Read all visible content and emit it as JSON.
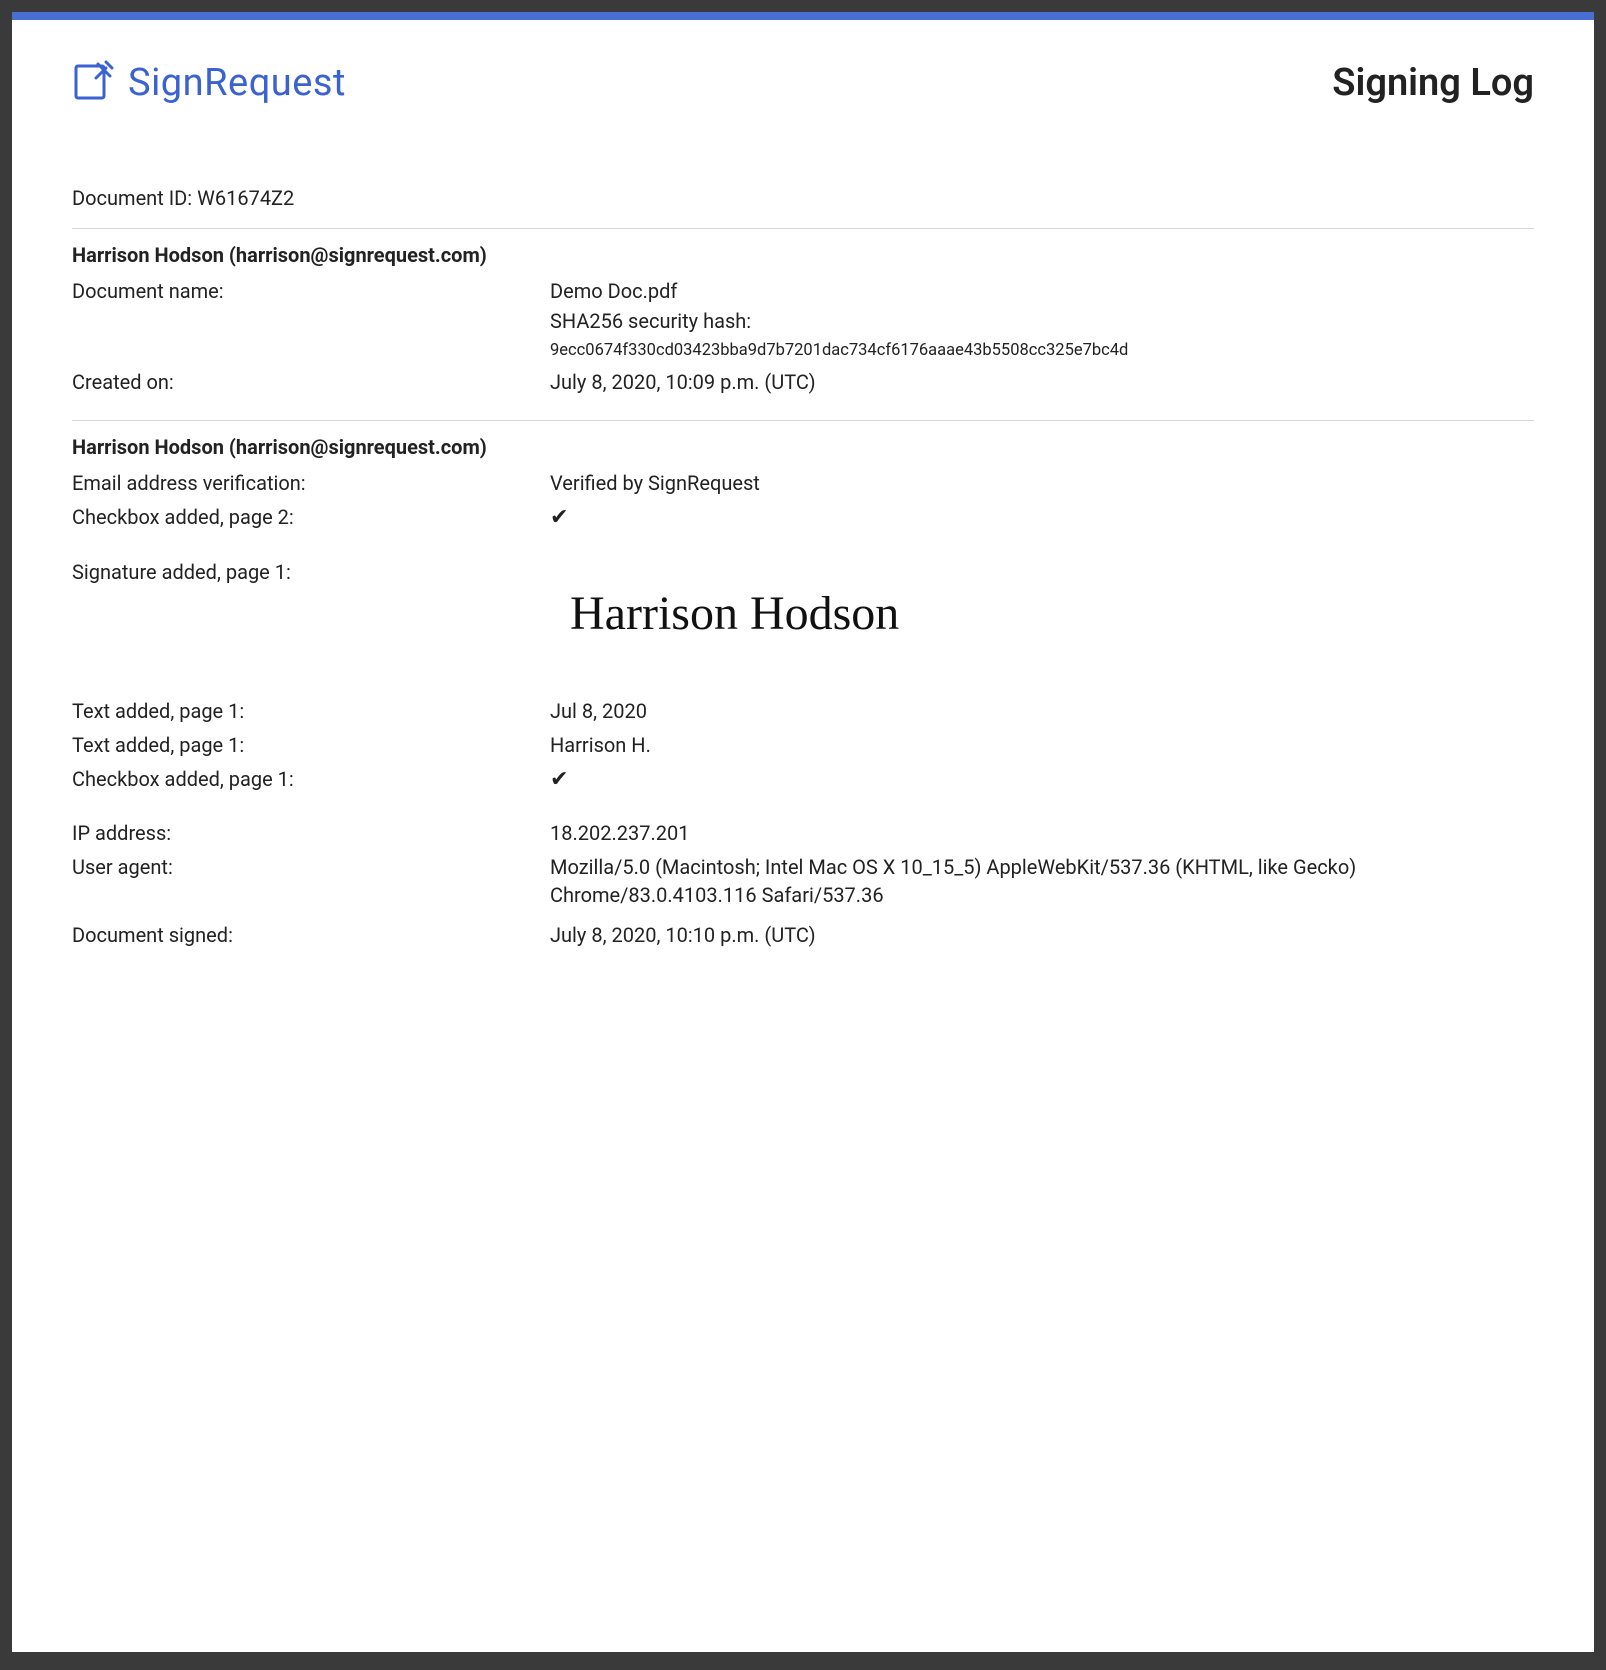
{
  "brand": "SignRequest",
  "page_title": "Signing Log",
  "document_id_label": "Document ID:",
  "document_id_value": "W61674Z2",
  "section1": {
    "header": "Harrison Hodson (harrison@signrequest.com)",
    "doc_name_label": "Document name:",
    "doc_name_value": "Demo Doc.pdf",
    "hash_label": "SHA256 security hash:",
    "hash_value": "9ecc0674f330cd03423bba9d7b7201dac734cf6176aaae43b5508cc325e7bc4d",
    "created_label": "Created on:",
    "created_value": "July 8, 2020, 10:09 p.m. (UTC)"
  },
  "section2": {
    "header": "Harrison Hodson (harrison@signrequest.com)",
    "email_verif_label": "Email address verification:",
    "email_verif_value": "Verified by SignRequest",
    "checkbox2_label": "Checkbox added, page 2:",
    "checkbox2_value": "✔",
    "sig_label": "Signature added, page 1:",
    "sig_value": "Harrison Hodson",
    "text1_label": "Text added, page 1:",
    "text1_value": "Jul 8, 2020",
    "text2_label": "Text added, page 1:",
    "text2_value": "Harrison H.",
    "checkbox1_label": "Checkbox added, page 1:",
    "checkbox1_value": "✔",
    "ip_label": "IP address:",
    "ip_value": "18.202.237.201",
    "ua_label": "User agent:",
    "ua_value": "Mozilla/5.0 (Macintosh; Intel Mac OS X 10_15_5) AppleWebKit/537.36 (KHTML, like Gecko) Chrome/83.0.4103.116 Safari/537.36",
    "signed_label": "Document signed:",
    "signed_value": "July 8, 2020, 10:10 p.m. (UTC)"
  }
}
